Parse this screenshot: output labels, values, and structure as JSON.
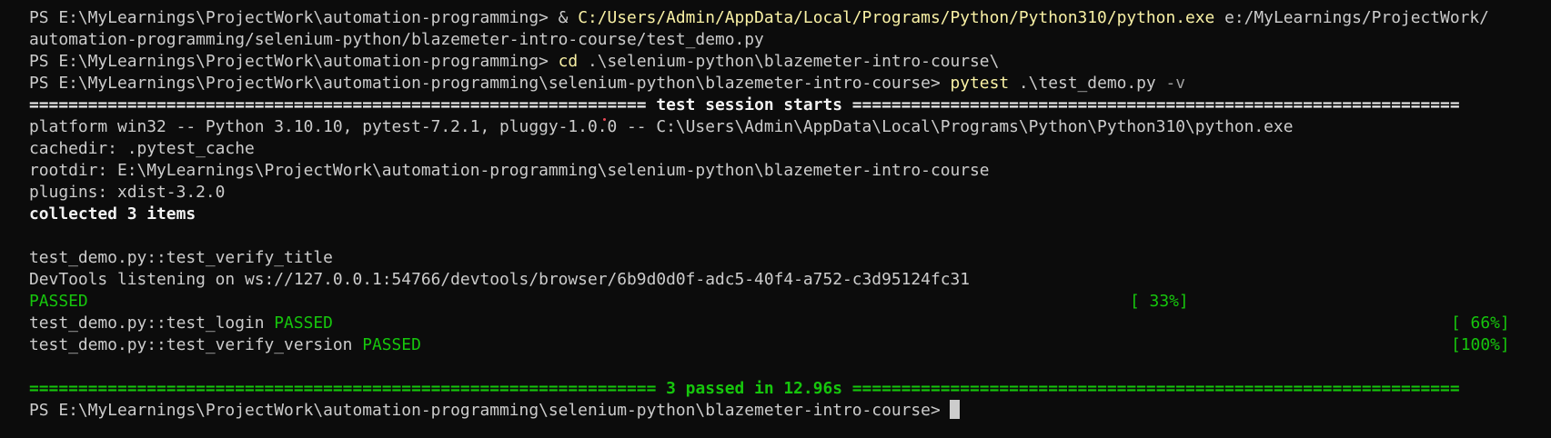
{
  "terminal": {
    "lines": {
      "l1_prompt": "PS E:\\MyLearnings\\ProjectWork\\automation-programming> ",
      "l1_amp": "& ",
      "l1_exe": "C:/Users/Admin/AppData/Local/Programs/Python/Python310/python.exe",
      "l1_arg": " e:/MyLearnings/ProjectWork/",
      "l2": "automation-programming/selenium-python/blazemeter-intro-course/test_demo.py",
      "l3_prompt": "PS E:\\MyLearnings\\ProjectWork\\automation-programming> ",
      "l3_cmd": "cd",
      "l3_arg": " .\\selenium-python\\blazemeter-intro-course\\",
      "l4_prompt": "PS E:\\MyLearnings\\ProjectWork\\automation-programming\\selenium-python\\blazemeter-intro-course> ",
      "l4_cmd": "pytest",
      "l4_arg": " .\\test_demo.py ",
      "l4_flag": "-v",
      "l5_left": "=============================================================== ",
      "l5_title": "test session starts",
      "l5_right": " ==============================================================",
      "l6": "platform win32 -- Python 3.10.10, pytest-7.2.1, pluggy-1.0.0 -- C:\\Users\\Admin\\AppData\\Local\\Programs\\Python\\Python310\\python.exe",
      "l7": "cachedir: .pytest_cache",
      "l8": "rootdir: E:\\MyLearnings\\ProjectWork\\automation-programming\\selenium-python\\blazemeter-intro-course",
      "l9": "plugins: xdist-3.2.0",
      "l10": "collected 3 items",
      "l12": "test_demo.py::test_verify_title",
      "l13": "DevTools listening on ws://127.0.0.1:54766/devtools/browser/6b9d0d0f-adc5-40f4-a752-c3d95124fc31",
      "l14_status": "PASSED",
      "l14_pct": "[ 33%]",
      "l15_test": "test_demo.py::test_login ",
      "l15_status": "PASSED",
      "l15_pct": "[ 66%]",
      "l16_test": "test_demo.py::test_verify_version ",
      "l16_status": "PASSED",
      "l16_pct": "[100%]",
      "l18_left": "================================================================ ",
      "l18_summary": "3 passed in 12.96s",
      "l18_right": " ==============================================================",
      "l19_prompt": "PS E:\\MyLearnings\\ProjectWork\\automation-programming\\selenium-python\\blazemeter-intro-course> "
    }
  },
  "colors": {
    "background": "#0c0c0c",
    "foreground": "#cccccc",
    "yellow": "#f9f1a5",
    "green": "#16c60c"
  }
}
